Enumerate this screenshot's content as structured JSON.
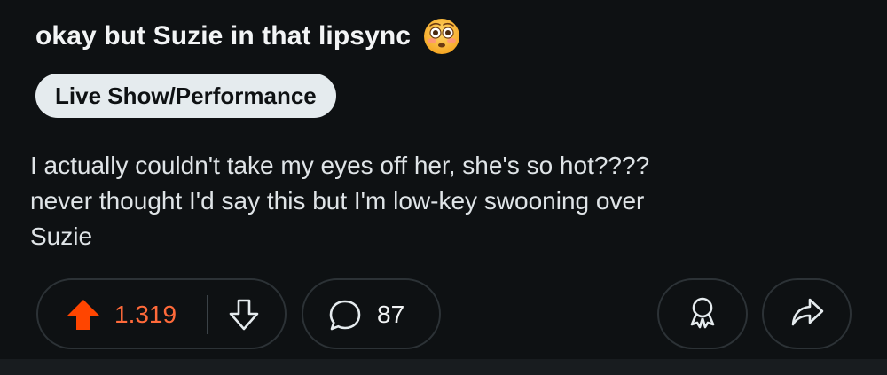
{
  "post": {
    "title": "okay but Suzie in that lipsync",
    "title_emoji": "flushed-face-emoji",
    "flair": "Live Show/Performance",
    "body": "I actually couldn't take my eyes off her, she's so hot????\nnever thought I'd say this but I'm low-key swooning over\nSuzie"
  },
  "actions": {
    "vote_count": "1.319",
    "comment_count": "87",
    "upvote_icon": "upvote-arrow-icon",
    "downvote_icon": "downvote-arrow-icon",
    "comment_icon": "comment-bubble-icon",
    "award_icon": "award-ribbon-icon",
    "share_icon": "share-arrow-icon"
  },
  "colors": {
    "background": "#0e1113",
    "upvote_active": "#ff4500",
    "vote_count": "#ff6a3a",
    "flair_background": "#e5ebee",
    "pill_border": "#2c3236"
  }
}
